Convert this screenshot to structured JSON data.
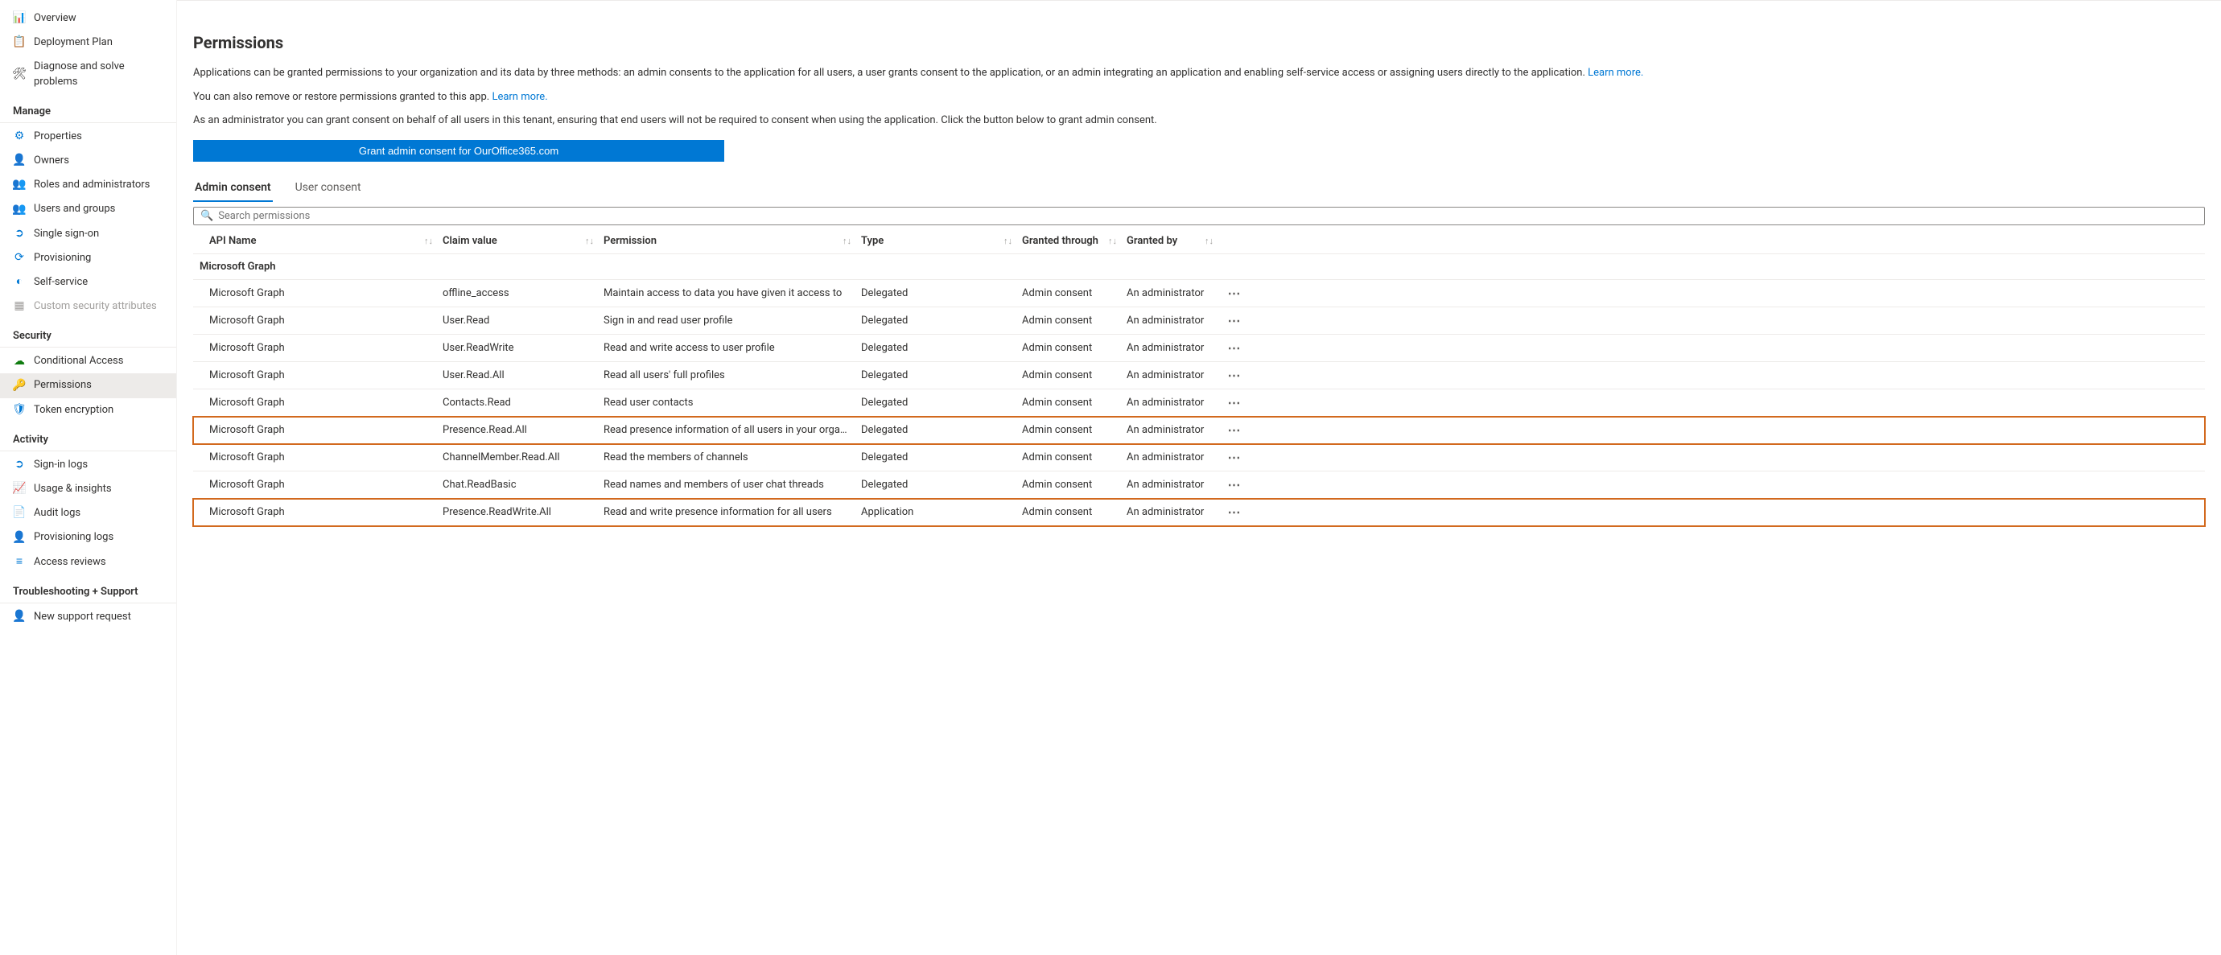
{
  "sidebar": {
    "top": [
      {
        "icon": "📊",
        "label": "Overview",
        "name": "overview"
      },
      {
        "icon": "📋",
        "label": "Deployment Plan",
        "name": "deployment-plan"
      },
      {
        "icon": "🛠",
        "label": "Diagnose and solve problems",
        "name": "diagnose"
      }
    ],
    "manage_title": "Manage",
    "manage": [
      {
        "icon": "⚙",
        "label": "Properties",
        "name": "properties",
        "color": "#0078d4"
      },
      {
        "icon": "👤",
        "label": "Owners",
        "name": "owners",
        "color": "#0078d4"
      },
      {
        "icon": "👥",
        "label": "Roles and administrators",
        "name": "roles",
        "color": "#107c10"
      },
      {
        "icon": "👥",
        "label": "Users and groups",
        "name": "users-groups",
        "color": "#0078d4"
      },
      {
        "icon": "➲",
        "label": "Single sign-on",
        "name": "sso",
        "color": "#0078d4"
      },
      {
        "icon": "⟳",
        "label": "Provisioning",
        "name": "provisioning",
        "color": "#0078d4"
      },
      {
        "icon": "◐",
        "label": "Self-service",
        "name": "self-service",
        "color": "#0078d4"
      },
      {
        "icon": "▦",
        "label": "Custom security attributes",
        "name": "custom-sec-attr",
        "disabled": true,
        "color": "#a19f9d"
      }
    ],
    "security_title": "Security",
    "security": [
      {
        "icon": "☁",
        "label": "Conditional Access",
        "name": "conditional-access",
        "color": "#107c10"
      },
      {
        "icon": "🔑",
        "label": "Permissions",
        "name": "permissions",
        "active": true,
        "color": "#107c10"
      },
      {
        "icon": "🛡",
        "label": "Token encryption",
        "name": "token-encryption",
        "color": "#0078d4"
      }
    ],
    "activity_title": "Activity",
    "activity": [
      {
        "icon": "➲",
        "label": "Sign-in logs",
        "name": "signin-logs",
        "color": "#0078d4"
      },
      {
        "icon": "📈",
        "label": "Usage & insights",
        "name": "usage-insights",
        "color": "#0078d4"
      },
      {
        "icon": "📄",
        "label": "Audit logs",
        "name": "audit-logs",
        "color": "#0078d4"
      },
      {
        "icon": "👤",
        "label": "Provisioning logs",
        "name": "provisioning-logs",
        "color": "#323130"
      },
      {
        "icon": "≡",
        "label": "Access reviews",
        "name": "access-reviews",
        "color": "#0078d4"
      }
    ],
    "support_title": "Troubleshooting + Support",
    "support": [
      {
        "icon": "👤",
        "label": "New support request",
        "name": "new-support",
        "color": "#0078d4"
      }
    ]
  },
  "main": {
    "page_title": "Permissions",
    "desc1a": "Applications can be granted permissions to your organization and its data by three methods: an admin consents to the application for all users, a user grants consent to the application, or an admin integrating an application and enabling self-service access or assigning users directly to the application. ",
    "desc1_link": "Learn more.",
    "desc2a": "You can also remove or restore permissions granted to this app. ",
    "desc2_link": "Learn more.",
    "desc3": "As an administrator you can grant consent on behalf of all users in this tenant, ensuring that end users will not be required to consent when using the application. Click the button below to grant admin consent.",
    "grant_button": "Grant admin consent for OurOffice365.com",
    "tabs": {
      "admin": "Admin consent",
      "user": "User consent"
    },
    "search_placeholder": "Search permissions",
    "columns": [
      "API Name",
      "Claim value",
      "Permission",
      "Type",
      "Granted through",
      "Granted by"
    ],
    "group_header": "Microsoft Graph",
    "rows": [
      {
        "api": "Microsoft Graph",
        "claim": "offline_access",
        "perm": "Maintain access to data you have given it access to",
        "type": "Delegated",
        "granted_through": "Admin consent",
        "granted_by": "An administrator"
      },
      {
        "api": "Microsoft Graph",
        "claim": "User.Read",
        "perm": "Sign in and read user profile",
        "type": "Delegated",
        "granted_through": "Admin consent",
        "granted_by": "An administrator"
      },
      {
        "api": "Microsoft Graph",
        "claim": "User.ReadWrite",
        "perm": "Read and write access to user profile",
        "type": "Delegated",
        "granted_through": "Admin consent",
        "granted_by": "An administrator"
      },
      {
        "api": "Microsoft Graph",
        "claim": "User.Read.All",
        "perm": "Read all users' full profiles",
        "type": "Delegated",
        "granted_through": "Admin consent",
        "granted_by": "An administrator"
      },
      {
        "api": "Microsoft Graph",
        "claim": "Contacts.Read",
        "perm": "Read user contacts",
        "type": "Delegated",
        "granted_through": "Admin consent",
        "granted_by": "An administrator"
      },
      {
        "api": "Microsoft Graph",
        "claim": "Presence.Read.All",
        "perm": "Read presence information of all users in your organization",
        "type": "Delegated",
        "granted_through": "Admin consent",
        "granted_by": "An administrator",
        "highlighted": true
      },
      {
        "api": "Microsoft Graph",
        "claim": "ChannelMember.Read.All",
        "perm": "Read the members of channels",
        "type": "Delegated",
        "granted_through": "Admin consent",
        "granted_by": "An administrator"
      },
      {
        "api": "Microsoft Graph",
        "claim": "Chat.ReadBasic",
        "perm": "Read names and members of user chat threads",
        "type": "Delegated",
        "granted_through": "Admin consent",
        "granted_by": "An administrator"
      },
      {
        "api": "Microsoft Graph",
        "claim": "Presence.ReadWrite.All",
        "perm": "Read and write presence information for all users",
        "type": "Application",
        "granted_through": "Admin consent",
        "granted_by": "An administrator",
        "highlighted": true
      }
    ]
  }
}
